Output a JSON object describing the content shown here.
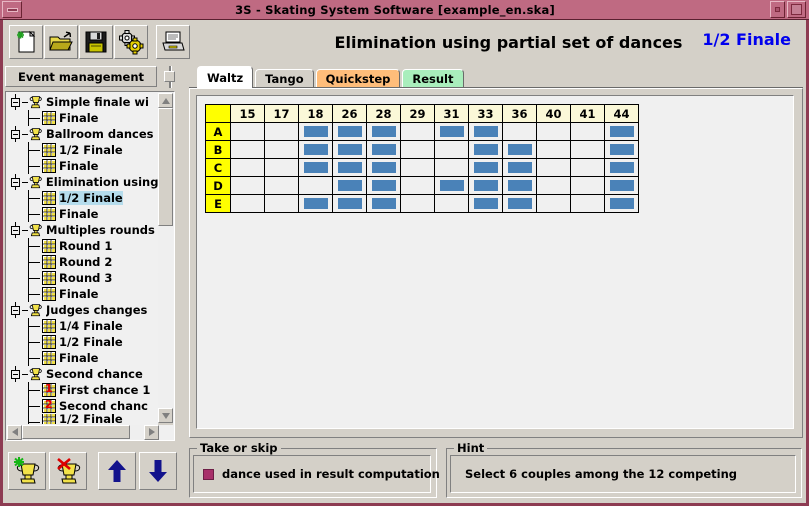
{
  "window": {
    "title": "3S - Skating System Software     [example_en.ska]",
    "minimize_icon": "minimize-icon",
    "restore_icon": "restore-icon",
    "maximize_icon": "maximize-icon"
  },
  "toolbar": {
    "buttons": [
      {
        "name": "new-file-button",
        "icon": "new-document-icon",
        "label": "New"
      },
      {
        "name": "open-file-button",
        "icon": "open-folder-icon",
        "label": "Open"
      },
      {
        "name": "save-file-button",
        "icon": "floppy-disk-icon",
        "label": "Save"
      },
      {
        "name": "settings-button",
        "icon": "gears-icon",
        "label": "Settings"
      },
      {
        "name": "print-button",
        "icon": "printer-icon",
        "label": "Print"
      }
    ]
  },
  "header": {
    "title": "Elimination using partial set of dances",
    "round": "1/2 Finale",
    "round_color": "#0000ee"
  },
  "sidebar": {
    "panel_button": "Event management",
    "tree": [
      {
        "label": "Simple finale wi",
        "type": "event",
        "depth": 0,
        "expanded": true
      },
      {
        "label": "Finale",
        "type": "round",
        "depth": 1
      },
      {
        "label": "Ballroom dances",
        "type": "event",
        "depth": 0,
        "expanded": true
      },
      {
        "label": "1/2 Finale",
        "type": "round",
        "depth": 1
      },
      {
        "label": "Finale",
        "type": "round",
        "depth": 1
      },
      {
        "label": "Elimination using",
        "type": "event",
        "depth": 0,
        "expanded": true
      },
      {
        "label": "1/2 Finale",
        "type": "round",
        "depth": 1,
        "selected": true
      },
      {
        "label": "Finale",
        "type": "round",
        "depth": 1
      },
      {
        "label": "Multiples rounds",
        "type": "event",
        "depth": 0,
        "expanded": true
      },
      {
        "label": "Round 1",
        "type": "round",
        "depth": 1
      },
      {
        "label": "Round 2",
        "type": "round",
        "depth": 1
      },
      {
        "label": "Round 3",
        "type": "round",
        "depth": 1
      },
      {
        "label": "Finale",
        "type": "round",
        "depth": 1
      },
      {
        "label": "Judges changes",
        "type": "event",
        "depth": 0,
        "expanded": true
      },
      {
        "label": "1/4 Finale",
        "type": "round",
        "depth": 1
      },
      {
        "label": "1/2 Finale",
        "type": "round",
        "depth": 1
      },
      {
        "label": "Finale",
        "type": "round",
        "depth": 1
      },
      {
        "label": "Second chance",
        "type": "event",
        "depth": 0,
        "expanded": true
      },
      {
        "label": "First chance 1",
        "type": "round",
        "depth": 1,
        "badge": "1"
      },
      {
        "label": "Second chanc",
        "type": "round",
        "depth": 1,
        "badge": "2"
      },
      {
        "label": "1/2 Finale",
        "type": "round",
        "depth": 1,
        "clipped": true
      }
    ],
    "buttons": [
      {
        "name": "add-event-button",
        "icon": "trophy-add-icon"
      },
      {
        "name": "delete-event-button",
        "icon": "trophy-delete-icon"
      },
      {
        "name": "move-up-button",
        "icon": "arrow-up-icon"
      },
      {
        "name": "move-down-button",
        "icon": "arrow-down-icon"
      }
    ]
  },
  "main": {
    "tabs": [
      {
        "label": "Waltz",
        "active": true,
        "color": "#ffffff"
      },
      {
        "label": "Tango",
        "active": false,
        "color": "#d4d0c8"
      },
      {
        "label": "Quickstep",
        "active": false,
        "color": "#ffbd7a"
      },
      {
        "label": "Result",
        "active": false,
        "color": "#a9eebc"
      }
    ],
    "grid": {
      "corner_label": "",
      "columns": [
        "15",
        "17",
        "18",
        "26",
        "28",
        "29",
        "31",
        "33",
        "36",
        "40",
        "41",
        "44"
      ],
      "rows": [
        {
          "label": "A",
          "marks": [
            false,
            false,
            true,
            true,
            true,
            false,
            true,
            true,
            false,
            false,
            false,
            true
          ]
        },
        {
          "label": "B",
          "marks": [
            false,
            false,
            true,
            true,
            true,
            false,
            false,
            true,
            true,
            false,
            false,
            true
          ]
        },
        {
          "label": "C",
          "marks": [
            false,
            false,
            true,
            true,
            true,
            false,
            false,
            true,
            true,
            false,
            false,
            true
          ]
        },
        {
          "label": "D",
          "marks": [
            false,
            false,
            false,
            true,
            true,
            false,
            true,
            true,
            true,
            false,
            false,
            true
          ]
        },
        {
          "label": "E",
          "marks": [
            false,
            false,
            true,
            true,
            true,
            false,
            false,
            true,
            true,
            false,
            false,
            true
          ]
        }
      ],
      "mark_color": "#4a82b8",
      "header_color": "#fbf8d8",
      "rowheader_color": "#ffff00"
    }
  },
  "bottom": {
    "take_or_skip": {
      "legend": "Take or skip",
      "checkbox_label": "dance used in result computation",
      "swatch_color": "#a8306a"
    },
    "hint": {
      "legend": "Hint",
      "text": "Select 6 couples among the 12 competing"
    }
  }
}
